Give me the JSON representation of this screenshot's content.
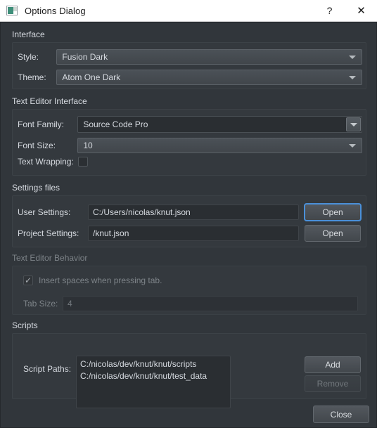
{
  "window": {
    "title": "Options Dialog",
    "icon": "app-icon",
    "help_label": "?",
    "close_label": "✕"
  },
  "groups": {
    "interface": {
      "title": "Interface",
      "style": {
        "label": "Style:",
        "value": "Fusion Dark"
      },
      "theme": {
        "label": "Theme:",
        "value": "Atom One Dark"
      }
    },
    "text_editor_interface": {
      "title": "Text Editor Interface",
      "font_family": {
        "label": "Font Family:",
        "value": "Source Code Pro"
      },
      "font_size": {
        "label": "Font Size:",
        "value": "10"
      },
      "text_wrapping": {
        "label": "Text Wrapping:",
        "checked": false
      }
    },
    "settings_files": {
      "title": "Settings files",
      "user_settings": {
        "label": "User Settings:",
        "value": "C:/Users/nicolas/knut.json",
        "button": "Open"
      },
      "project_settings": {
        "label": "Project Settings:",
        "value": "/knut.json",
        "button": "Open"
      }
    },
    "text_editor_behavior": {
      "title": "Text Editor Behavior",
      "enabled": false,
      "insert_spaces": {
        "label": "Insert spaces when pressing tab.",
        "checked": true
      },
      "tab_size": {
        "label": "Tab Size:",
        "value": "4"
      }
    },
    "scripts": {
      "title": "Scripts",
      "script_paths": {
        "label": "Script Paths:",
        "items": [
          "C:/nicolas/dev/knut/knut/scripts",
          "C:/nicolas/dev/knut/knut/test_data"
        ]
      },
      "add_button": "Add",
      "remove_button": "Remove"
    }
  },
  "footer": {
    "close_button": "Close"
  },
  "colors": {
    "dialog_background": "#31363b",
    "group_background": "#34393e",
    "field_background": "#2a2e32",
    "text": "#d6dae0",
    "disabled_text": "#7e8489",
    "focus_accent": "#4a90d9",
    "titlebar_background": "#ffffff",
    "titlebar_text": "#1a1a1a"
  }
}
